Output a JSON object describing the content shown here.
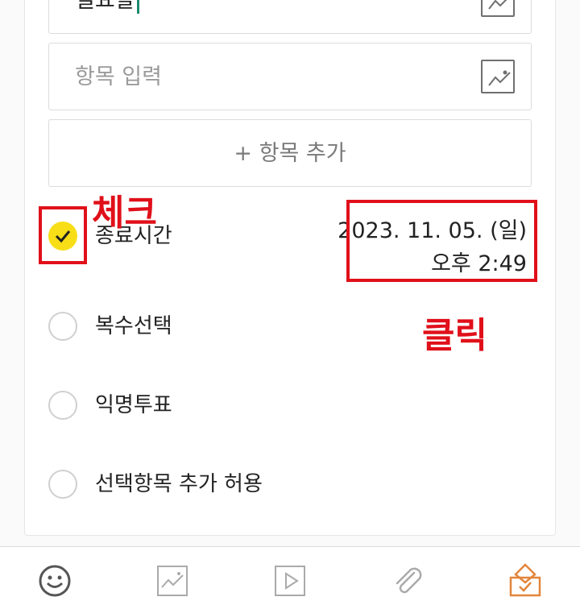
{
  "form": {
    "item1_value": "필요할",
    "item2_placeholder": "항목 입력",
    "add_item_label": "+ 항목 추가"
  },
  "options": [
    {
      "label": "종료시간",
      "checked": true
    },
    {
      "label": "복수선택",
      "checked": false
    },
    {
      "label": "익명투표",
      "checked": false
    },
    {
      "label": "선택항목 추가 허용",
      "checked": false
    }
  ],
  "end_time": {
    "date": "2023. 11. 05. (일)",
    "time": "오후 2:49"
  },
  "annotations": {
    "check": "체크",
    "click": "클릭"
  },
  "toolbar": {
    "icons": [
      "emoji-icon",
      "image-icon",
      "video-icon",
      "attach-icon",
      "vote-icon"
    ]
  },
  "colors": {
    "check_yellow": "#f7de16",
    "annotation_red": "#e0101a",
    "vote_orange": "#e3863c"
  }
}
